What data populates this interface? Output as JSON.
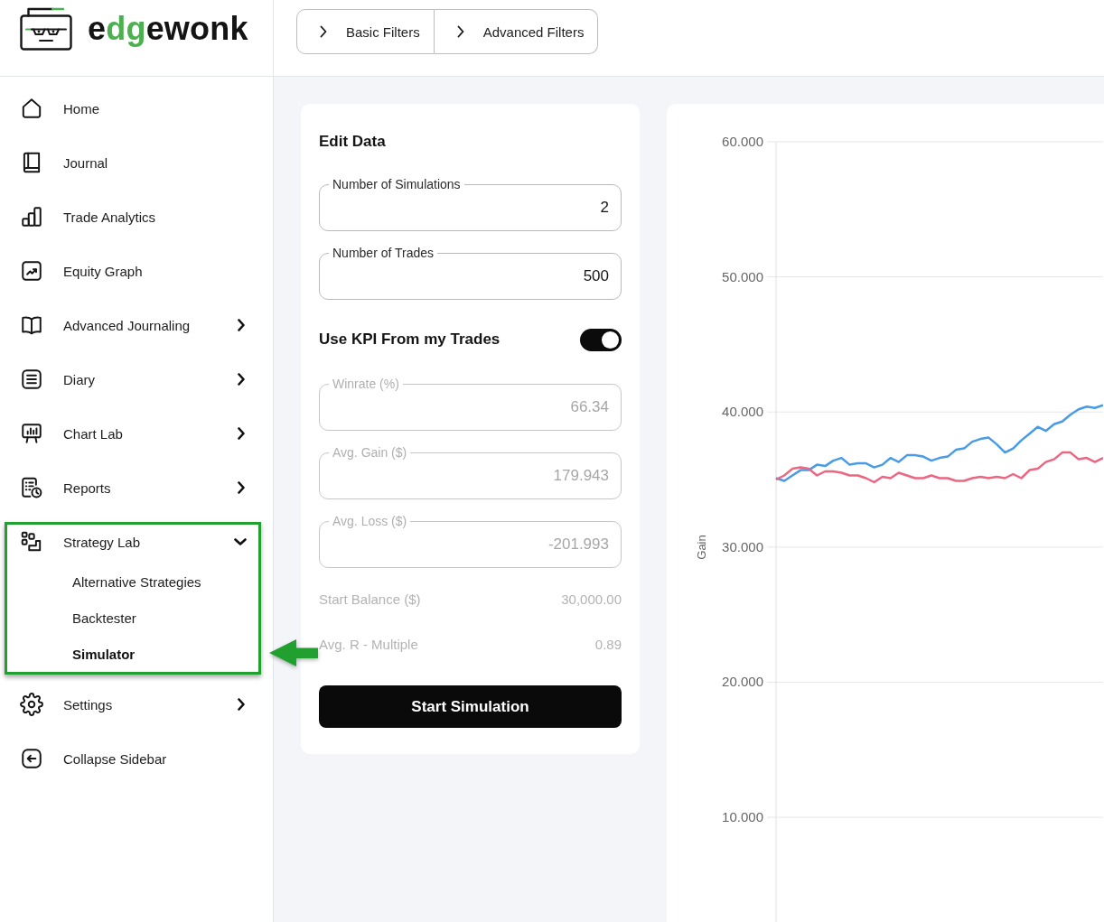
{
  "logo": {
    "parts": [
      {
        "text": "e",
        "accent": false
      },
      {
        "text": "dg",
        "accent": true
      },
      {
        "text": "ewonk",
        "accent": false
      }
    ]
  },
  "filters": [
    {
      "label": "Basic Filters"
    },
    {
      "label": "Advanced Filters"
    }
  ],
  "sidebar": {
    "items": [
      {
        "label": "Home",
        "kind": "link",
        "selected": false
      },
      {
        "label": "Journal",
        "kind": "link",
        "selected": false
      },
      {
        "label": "Trade Analytics",
        "kind": "link",
        "selected": false
      },
      {
        "label": "Equity Graph",
        "kind": "link",
        "selected": false
      },
      {
        "label": "Advanced Journaling",
        "kind": "menu",
        "expanded": false,
        "selected": false
      },
      {
        "label": "Diary",
        "kind": "menu",
        "expanded": false,
        "selected": false
      },
      {
        "label": "Chart Lab",
        "kind": "menu",
        "expanded": false,
        "selected": false
      },
      {
        "label": "Reports",
        "kind": "menu",
        "expanded": false,
        "selected": false
      },
      {
        "label": "Strategy Lab",
        "kind": "menu",
        "expanded": true,
        "selected": false,
        "highlighted": true,
        "children": [
          {
            "label": "Alternative Strategies",
            "selected": false
          },
          {
            "label": "Backtester",
            "selected": false
          },
          {
            "label": "Simulator",
            "selected": true,
            "arrow": true
          }
        ]
      },
      {
        "label": "Settings",
        "kind": "menu",
        "expanded": false,
        "selected": false
      },
      {
        "label": "Collapse Sidebar",
        "kind": "link",
        "selected": false
      }
    ]
  },
  "edit_data": {
    "title": "Edit Data",
    "fields": [
      {
        "label": "Number of Simulations",
        "value": "2",
        "disabled": false
      },
      {
        "label": "Number of Trades",
        "value": "500",
        "disabled": false
      }
    ],
    "kpi_toggle": {
      "label": "Use KPI From my Trades",
      "on": true
    },
    "kpi_fields": [
      {
        "label": "Winrate (%)",
        "value": "66.34",
        "disabled": true
      },
      {
        "label": "Avg. Gain ($)",
        "value": "179.943",
        "disabled": true
      },
      {
        "label": "Avg. Loss ($)",
        "value": "-201.993",
        "disabled": true
      }
    ],
    "stats": [
      {
        "label": "Start Balance ($)",
        "value": "30,000.00"
      },
      {
        "label": "Avg. R - Multiple",
        "value": "0.89"
      }
    ],
    "button": "Start Simulation"
  },
  "chart": {
    "chart_data": {
      "type": "line",
      "ylabel": "Gain",
      "grid": true,
      "ylim": [
        2.25,
        60
      ],
      "yticks": [
        {
          "value": 10,
          "label": "10.000"
        },
        {
          "value": 20,
          "label": "20.000"
        },
        {
          "value": 30,
          "label": "30.000"
        },
        {
          "value": 40,
          "label": "40.000"
        },
        {
          "value": 50,
          "label": "50.000"
        },
        {
          "value": 60,
          "label": "60.000"
        }
      ],
      "series": [
        {
          "color": "#4a9be6",
          "values": [
            35.1,
            34.9,
            35.3,
            35.7,
            35.7,
            36.1,
            36.0,
            36.4,
            36.6,
            36.1,
            36.2,
            36.2,
            35.9,
            36.1,
            36.6,
            36.3,
            36.8,
            36.8,
            36.7,
            36.4,
            36.6,
            36.7,
            37.2,
            37.3,
            37.8,
            38.0,
            38.1,
            37.6,
            37.0,
            37.3,
            37.9,
            38.4,
            38.9,
            38.6,
            39.1,
            39.3,
            39.8,
            40.2,
            40.4,
            40.3,
            40.5
          ]
        },
        {
          "color": "#ec6681",
          "values": [
            35.0,
            35.3,
            35.8,
            35.9,
            35.8,
            35.3,
            35.6,
            35.6,
            35.5,
            35.3,
            35.3,
            35.1,
            34.8,
            35.2,
            35.1,
            35.5,
            35.3,
            35.1,
            35.1,
            35.3,
            35.1,
            35.1,
            34.9,
            34.9,
            35.1,
            35.2,
            35.1,
            35.2,
            35.1,
            35.4,
            35.1,
            35.7,
            35.8,
            36.3,
            36.5,
            37.0,
            37.0,
            36.5,
            36.6,
            36.3,
            36.6
          ]
        }
      ]
    }
  }
}
